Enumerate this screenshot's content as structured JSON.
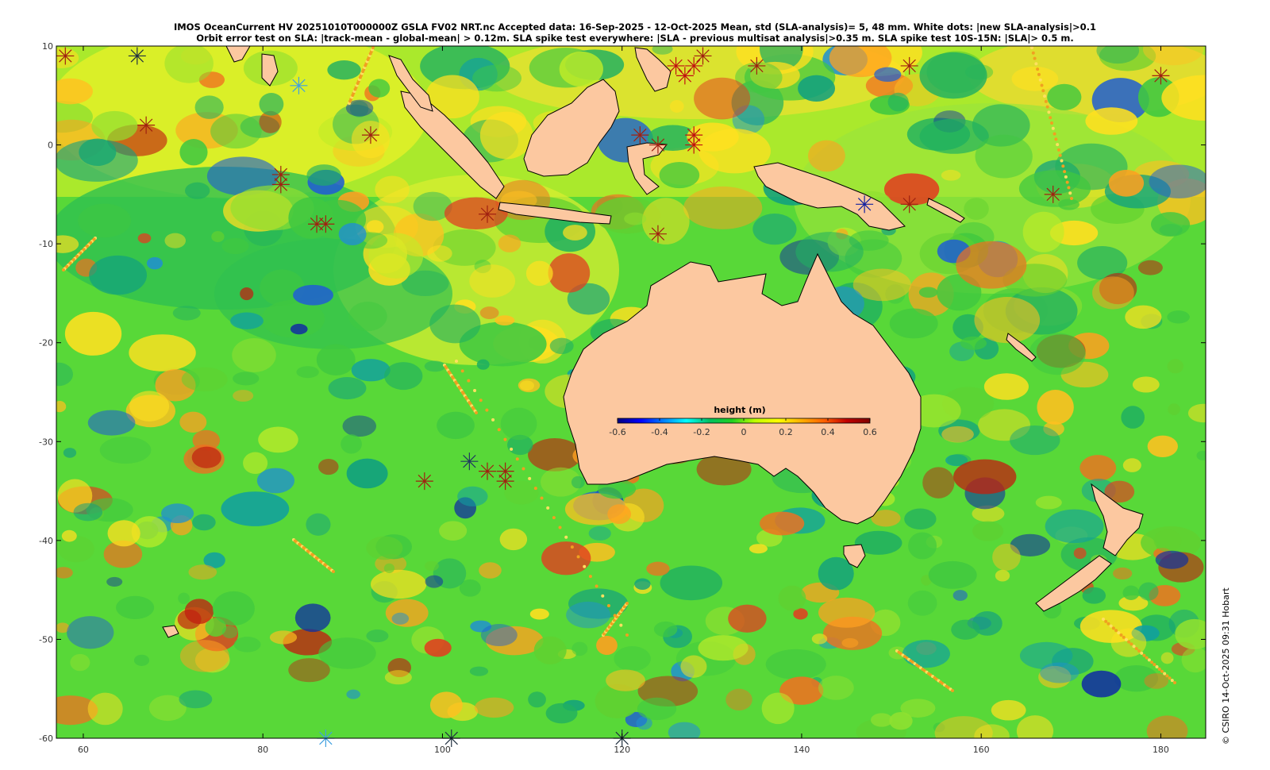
{
  "title": {
    "line1": "IMOS OceanCurrent HV 20251010T000000Z GSLA FV02 NRT.nc  Accepted data: 16-Sep-2025 - 12-Oct-2025 Mean, std (SLA-analysis)= 5, 48 mm. White dots: |new SLA-analysis|>0.1",
    "line2": "Orbit error test on SLA: |track-mean  - global-mean| > 0.12m.  SLA spike test everywhere: |SLA - previous multisat analysis|>0.35 m. SLA spike test 10S-15N: |SLA|> 0.5 m."
  },
  "credit": "© CSIRO 14-Oct-2025 09:31 Hobart",
  "map": {
    "lon_range": [
      57,
      185
    ],
    "lat_range": [
      -60,
      10
    ],
    "lon_ticks": [
      60,
      80,
      100,
      120,
      140,
      160,
      180
    ],
    "lat_ticks": [
      10,
      0,
      -10,
      -20,
      -30,
      -40,
      -50,
      -60
    ],
    "land_color": "#fcc8a0",
    "colorbar": {
      "label": "height (m)",
      "range": [
        -0.6,
        0.6
      ],
      "ticks": [
        "-0.6",
        "-0.4",
        "-0.2",
        "0",
        "0.2",
        "0.4",
        "0.6"
      ],
      "colors": [
        "#00007f",
        "#0000ff",
        "#0080ff",
        "#00ffff",
        "#00c060",
        "#20d020",
        "#c0ff00",
        "#ffff00",
        "#ffb000",
        "#ff6000",
        "#c00000",
        "#7f0000"
      ]
    },
    "star_markers": [
      {
        "lon": 58,
        "lat": 9,
        "color": "#a02010"
      },
      {
        "lon": 66,
        "lat": 9,
        "color": "#203040"
      },
      {
        "lon": 84,
        "lat": 6,
        "color": "#40a0e0"
      },
      {
        "lon": 67,
        "lat": 2,
        "color": "#a02010"
      },
      {
        "lon": 92,
        "lat": 1,
        "color": "#a02010"
      },
      {
        "lon": 82,
        "lat": -3,
        "color": "#a02010"
      },
      {
        "lon": 82,
        "lat": -4,
        "color": "#a02010"
      },
      {
        "lon": 86,
        "lat": -8,
        "color": "#a02010"
      },
      {
        "lon": 87,
        "lat": -8,
        "color": "#a02010"
      },
      {
        "lon": 105,
        "lat": -7,
        "color": "#a02010"
      },
      {
        "lon": 122,
        "lat": 1,
        "color": "#a02010"
      },
      {
        "lon": 124,
        "lat": 0,
        "color": "#a02010"
      },
      {
        "lon": 126,
        "lat": 8,
        "color": "#c01010"
      },
      {
        "lon": 127,
        "lat": 7,
        "color": "#c01010"
      },
      {
        "lon": 128,
        "lat": 8,
        "color": "#c01010"
      },
      {
        "lon": 129,
        "lat": 9,
        "color": "#a02010"
      },
      {
        "lon": 128,
        "lat": 1,
        "color": "#c01010"
      },
      {
        "lon": 128,
        "lat": 0,
        "color": "#c01010"
      },
      {
        "lon": 124,
        "lat": -9,
        "color": "#a02010"
      },
      {
        "lon": 135,
        "lat": 8,
        "color": "#a02010"
      },
      {
        "lon": 152,
        "lat": 8,
        "color": "#a02010"
      },
      {
        "lon": 180,
        "lat": 7,
        "color": "#a02010"
      },
      {
        "lon": 147,
        "lat": -6,
        "color": "#1020a0"
      },
      {
        "lon": 152,
        "lat": -6,
        "color": "#a02010"
      },
      {
        "lon": 168,
        "lat": -5,
        "color": "#a02010"
      },
      {
        "lon": 98,
        "lat": -34,
        "color": "#a02010"
      },
      {
        "lon": 103,
        "lat": -32,
        "color": "#203860"
      },
      {
        "lon": 105,
        "lat": -33,
        "color": "#a02010"
      },
      {
        "lon": 107,
        "lat": -33,
        "color": "#a02010"
      },
      {
        "lon": 107,
        "lat": -34,
        "color": "#a02010"
      },
      {
        "lon": 87,
        "lat": -60,
        "color": "#40a0e0"
      },
      {
        "lon": 101,
        "lat": -60,
        "color": "#203040"
      },
      {
        "lon": 120,
        "lat": -60,
        "color": "#203040"
      }
    ]
  }
}
